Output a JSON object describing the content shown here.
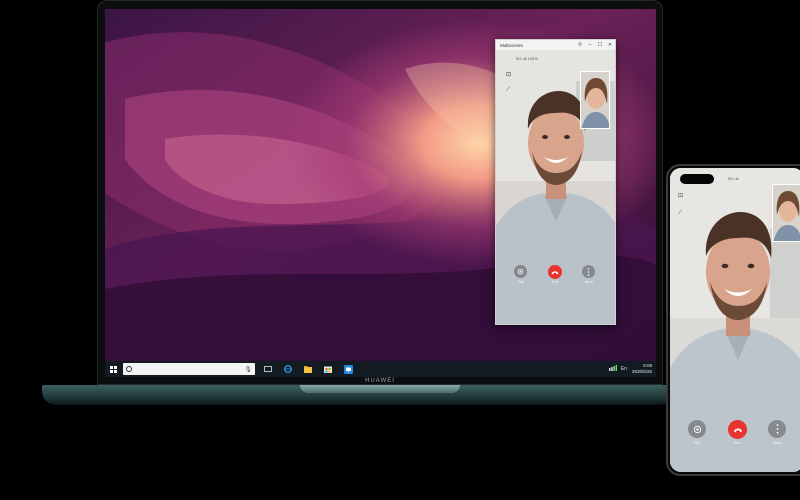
{
  "brand": {
    "laptop": "HUAWEI"
  },
  "taskbar": {
    "search_placeholder": "",
    "tray_lang": "En",
    "clock_time": "8:08",
    "clock_date": "2020/5/26",
    "icons": [
      "windows-start-icon",
      "cortana-icon",
      "mic-icon",
      "task-view-icon",
      "edge-icon",
      "file-explorer-icon",
      "store-icon",
      "multiscreen-app-icon",
      "network-icon"
    ]
  },
  "multiscreen_window": {
    "title": "Multiscreen",
    "controls": {
      "pin": "⚲",
      "minimize": "–",
      "maximize": "☐",
      "close": "✕"
    },
    "status": "5G ull 100%",
    "buttons": {
      "flip": "Flip",
      "end": "End",
      "more": "More"
    }
  },
  "phone": {
    "status": "5G ull",
    "buttons": {
      "flip": "Flip",
      "end": "End",
      "more": "More"
    }
  },
  "colors": {
    "end_call": "#e8332f",
    "laptop_base": "#1c3232",
    "taskbar": "#121a22"
  }
}
